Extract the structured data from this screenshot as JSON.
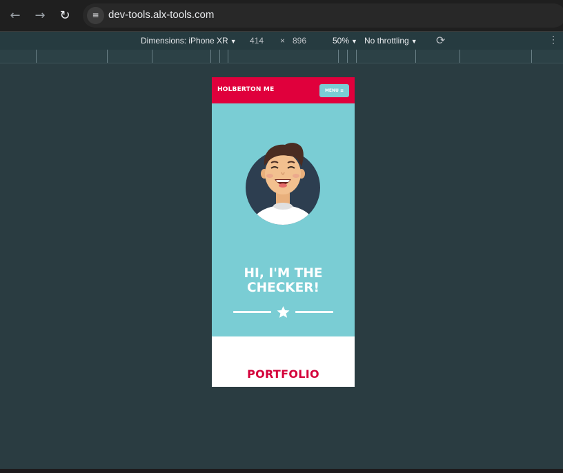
{
  "browser": {
    "url": "dev-tools.alx-tools.com",
    "icons": {
      "back": "arrow-left",
      "forward": "arrow-right",
      "reload": "reload",
      "site_info": "tune"
    }
  },
  "device_toolbar": {
    "dimensions_label": "Dimensions: iPhone XR",
    "width": "414",
    "times": "×",
    "height": "896",
    "zoom": "50%",
    "throttling": "No throttling"
  },
  "page": {
    "header": {
      "logo": "HOLBERTON ME",
      "menu_label": "MENU ≡"
    },
    "hero": {
      "title_line1": "HI, I'M THE",
      "title_line2": "CHECKER!"
    },
    "portfolio": {
      "title": "PORTFOLIO"
    }
  },
  "colors": {
    "header_red": "#e0003c",
    "hero_teal": "#7acdd4",
    "portfolio_red": "#d4003a",
    "devtools_bg": "#2a3c41"
  }
}
